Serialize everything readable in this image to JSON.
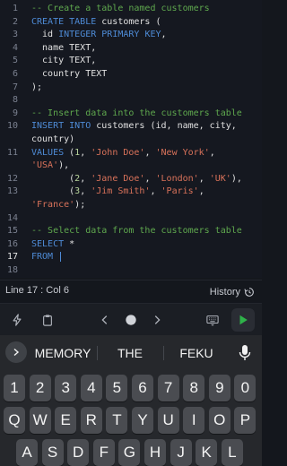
{
  "editor": {
    "active_line": 17,
    "lines": [
      {
        "n": "1",
        "tokens": [
          {
            "t": "-- Create a table named customers",
            "c": "comment"
          }
        ]
      },
      {
        "n": "2",
        "tokens": [
          {
            "t": "CREATE TABLE",
            "c": "kw"
          },
          {
            "t": " customers (",
            "c": "plain"
          }
        ]
      },
      {
        "n": "3",
        "tokens": [
          {
            "t": "  id ",
            "c": "plain"
          },
          {
            "t": "INTEGER PRIMARY KEY",
            "c": "kw"
          },
          {
            "t": ",",
            "c": "plain"
          }
        ]
      },
      {
        "n": "4",
        "tokens": [
          {
            "t": "  name TEXT,",
            "c": "plain"
          }
        ]
      },
      {
        "n": "5",
        "tokens": [
          {
            "t": "  city TEXT,",
            "c": "plain"
          }
        ]
      },
      {
        "n": "6",
        "tokens": [
          {
            "t": "  country TEXT",
            "c": "plain"
          }
        ]
      },
      {
        "n": "7",
        "tokens": [
          {
            "t": ");",
            "c": "plain"
          }
        ]
      },
      {
        "n": "8",
        "tokens": []
      },
      {
        "n": "9",
        "tokens": [
          {
            "t": "-- Insert data into the customers table",
            "c": "comment"
          }
        ]
      },
      {
        "n": "10",
        "tokens": [
          {
            "t": "INSERT INTO",
            "c": "kw"
          },
          {
            "t": " customers (id, name, city,",
            "c": "plain"
          }
        ]
      },
      {
        "n": "",
        "tokens": [
          {
            "t": "country)",
            "c": "plain"
          }
        ]
      },
      {
        "n": "11",
        "tokens": [
          {
            "t": "VALUES",
            "c": "kw"
          },
          {
            "t": " (",
            "c": "plain"
          },
          {
            "t": "1",
            "c": "num"
          },
          {
            "t": ", ",
            "c": "plain"
          },
          {
            "t": "'John Doe'",
            "c": "str"
          },
          {
            "t": ", ",
            "c": "plain"
          },
          {
            "t": "'New York'",
            "c": "str"
          },
          {
            "t": ",",
            "c": "plain"
          }
        ]
      },
      {
        "n": "",
        "tokens": [
          {
            "t": "'USA'",
            "c": "str"
          },
          {
            "t": "),",
            "c": "plain"
          }
        ]
      },
      {
        "n": "12",
        "tokens": [
          {
            "t": "       (",
            "c": "plain"
          },
          {
            "t": "2",
            "c": "num"
          },
          {
            "t": ", ",
            "c": "plain"
          },
          {
            "t": "'Jane Doe'",
            "c": "str"
          },
          {
            "t": ", ",
            "c": "plain"
          },
          {
            "t": "'London'",
            "c": "str"
          },
          {
            "t": ", ",
            "c": "plain"
          },
          {
            "t": "'UK'",
            "c": "str"
          },
          {
            "t": "),",
            "c": "plain"
          }
        ]
      },
      {
        "n": "13",
        "tokens": [
          {
            "t": "       (",
            "c": "plain"
          },
          {
            "t": "3",
            "c": "num"
          },
          {
            "t": ", ",
            "c": "plain"
          },
          {
            "t": "'Jim Smith'",
            "c": "str"
          },
          {
            "t": ", ",
            "c": "plain"
          },
          {
            "t": "'Paris'",
            "c": "str"
          },
          {
            "t": ",",
            "c": "plain"
          }
        ]
      },
      {
        "n": "",
        "tokens": [
          {
            "t": "'France'",
            "c": "str"
          },
          {
            "t": ");",
            "c": "plain"
          }
        ]
      },
      {
        "n": "14",
        "tokens": []
      },
      {
        "n": "15",
        "tokens": [
          {
            "t": "-- Select data from the customers table",
            "c": "comment"
          }
        ]
      },
      {
        "n": "16",
        "tokens": [
          {
            "t": "SELECT",
            "c": "kw"
          },
          {
            "t": " *",
            "c": "plain"
          }
        ]
      },
      {
        "n": "17",
        "tokens": [
          {
            "t": "FROM",
            "c": "kw"
          },
          {
            "t": " ",
            "c": "plain"
          }
        ],
        "cursor": true
      },
      {
        "n": "18",
        "tokens": []
      }
    ]
  },
  "status": {
    "position": "Line 17 : Col 6",
    "history_label": "History"
  },
  "toolbar": {
    "icons": [
      "lightning-icon",
      "clipboard-icon",
      "chevron-left-icon",
      "cursor-dot-icon",
      "chevron-right-icon",
      "keyboard-icon",
      "play-icon"
    ],
    "run_color": "#2fb34a"
  },
  "keyboard": {
    "suggestions": [
      "MEMORY",
      "THE",
      "FEKU"
    ],
    "rows": [
      [
        "1",
        "2",
        "3",
        "4",
        "5",
        "6",
        "7",
        "8",
        "9",
        "0"
      ],
      [
        "Q",
        "W",
        "E",
        "R",
        "T",
        "Y",
        "U",
        "I",
        "O",
        "P"
      ],
      [
        "A",
        "S",
        "D",
        "F",
        "G",
        "H",
        "J",
        "K",
        "L"
      ]
    ]
  }
}
